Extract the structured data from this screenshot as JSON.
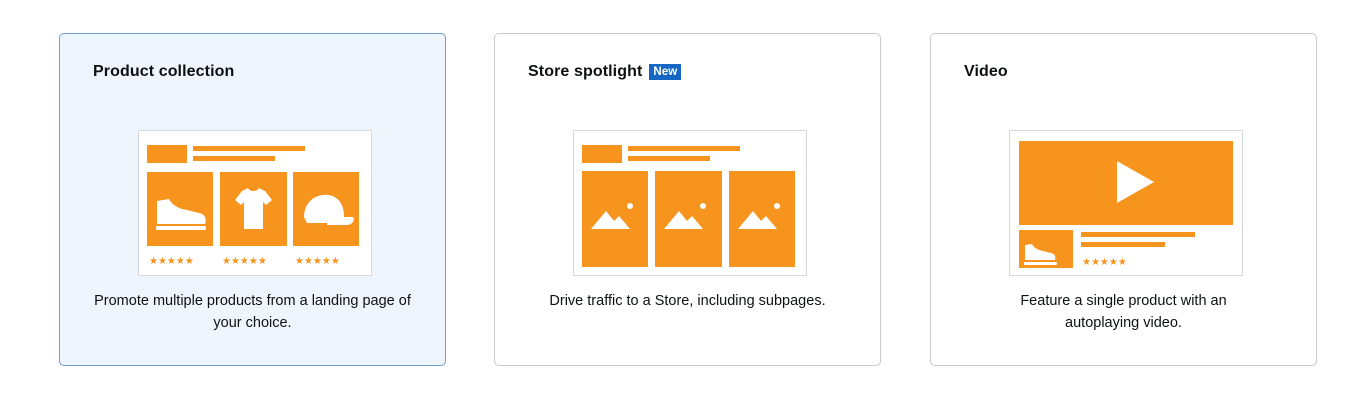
{
  "cards": [
    {
      "title": "Product collection",
      "badge": "",
      "description": "Promote multiple products from a landing page of your choice.",
      "illustration": "product-collection-illustration",
      "selected": true
    },
    {
      "title": "Store spotlight",
      "badge": "New",
      "description": "Drive traffic to a Store, including subpages.",
      "illustration": "store-spotlight-illustration",
      "selected": false
    },
    {
      "title": "Video",
      "badge": "",
      "description": "Feature a single product with an autoplaying video.",
      "illustration": "video-illustration",
      "selected": false
    }
  ],
  "colors": {
    "accent": "#f7941d",
    "badge_bg": "#1667c4",
    "selected_bg": "#eef5fd",
    "selected_border": "#6d9ecf"
  },
  "icons": [
    "shoe-icon",
    "tshirt-icon",
    "cap-icon",
    "image-placeholder-icon",
    "play-icon",
    "star-rating-icon"
  ]
}
